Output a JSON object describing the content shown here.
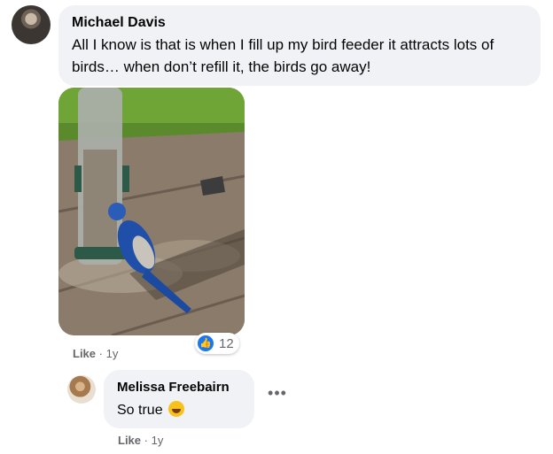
{
  "comment": {
    "author": "Michael Davis",
    "text": "All I know is that is when I fill up my bird feeder it attracts lots of birds… when don’t refill it, the birds go away!",
    "like_label": "Like",
    "separator": "·",
    "time": "1y",
    "reaction_icon": "like-thumb-icon",
    "reaction_count": "12",
    "reaction_color": "#1877f2"
  },
  "reply": {
    "author": "Melissa Freebairn",
    "text": "So true",
    "emoji": "laughing-tears-emoji",
    "like_label": "Like",
    "separator": "·",
    "time": "1y",
    "more_icon": "more-horizontal-icon",
    "more_glyph": "•••"
  }
}
